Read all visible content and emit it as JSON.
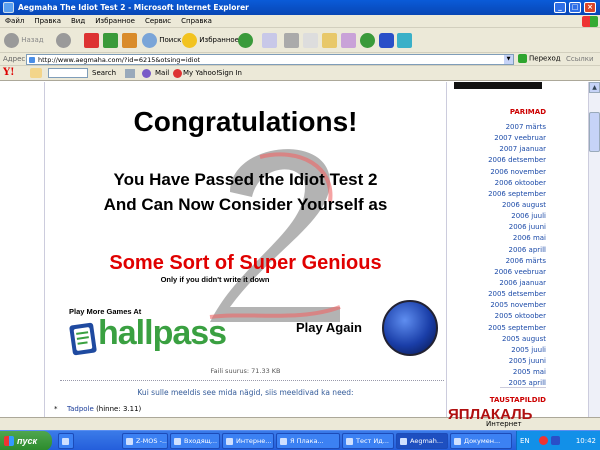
{
  "window": {
    "title": "Aegmaha The Idiot Test 2 - Microsoft Internet Explorer"
  },
  "menu": [
    "Файл",
    "Правка",
    "Вид",
    "Избранное",
    "Сервис",
    "Справка"
  ],
  "toolbar": {
    "back": "Назад",
    "search": "Поиск",
    "favorites": "Избранное"
  },
  "address": {
    "label": "Адрес:",
    "url": "http://www.aegmaha.com/?id=6215&otsing=idiot",
    "go": "Переход",
    "links": "Ссылки"
  },
  "yahoo": {
    "logo": "Y!",
    "search": "Search",
    "mail": "Mail",
    "my_yahoo": "My Yahoo!",
    "sign_in": "Sign In"
  },
  "game": {
    "title": "Congratulations!",
    "line1": "You Have Passed the Idiot Test 2",
    "line2": "And Can Now Consider Yourself as",
    "line3": "Some Sort of Super Genious",
    "note": "Only if you didn't write it down",
    "play_more": "Play More Games At",
    "hallpass": "hallpass",
    "play_again": "Play Again"
  },
  "file_size": "Faili suurus: 71.33 KB",
  "question": "Kui sulle meeldis see mida nägid, siis meeldivad ka need:",
  "related": [
    {
      "name": "Tadpole",
      "rating": "(hinne: 3.11)"
    }
  ],
  "sidebar": {
    "heading": "PARIMAD",
    "archive": [
      "2007 märts",
      "2007 veebruar",
      "2007 jaanuar",
      "2006 detsember",
      "2006 november",
      "2006 oktoober",
      "2006 september",
      "2006 august",
      "2006 juuli",
      "2006 juuni",
      "2006 mai",
      "2006 aprill",
      "2006 märts",
      "2006 veebruar",
      "2006 jaanuar",
      "2005 detsember",
      "2005 november",
      "2005 oktoober",
      "2005 september",
      "2005 august",
      "2005 juuli",
      "2005 juuni",
      "2005 mai",
      "2005 aprill"
    ],
    "heading2": "TAUSTAPILDID"
  },
  "status": {
    "zone": "Интернет",
    "watermark": "ЯПЛАКАЛЬ"
  },
  "taskbar": {
    "start": "пуск",
    "tasks": [
      "Z-MOS -...",
      "Входящ...",
      "Интерне...",
      "Я Плака...",
      "Тест Ид...",
      "Aegmah...",
      "Докумен..."
    ],
    "lang": "EN",
    "clock": "10:42"
  },
  "colors": {
    "accent_red": "#e00000",
    "link_blue": "#1b4aa8",
    "hallpass_green": "#3aa041",
    "title_blue": "#0a5bd8"
  }
}
